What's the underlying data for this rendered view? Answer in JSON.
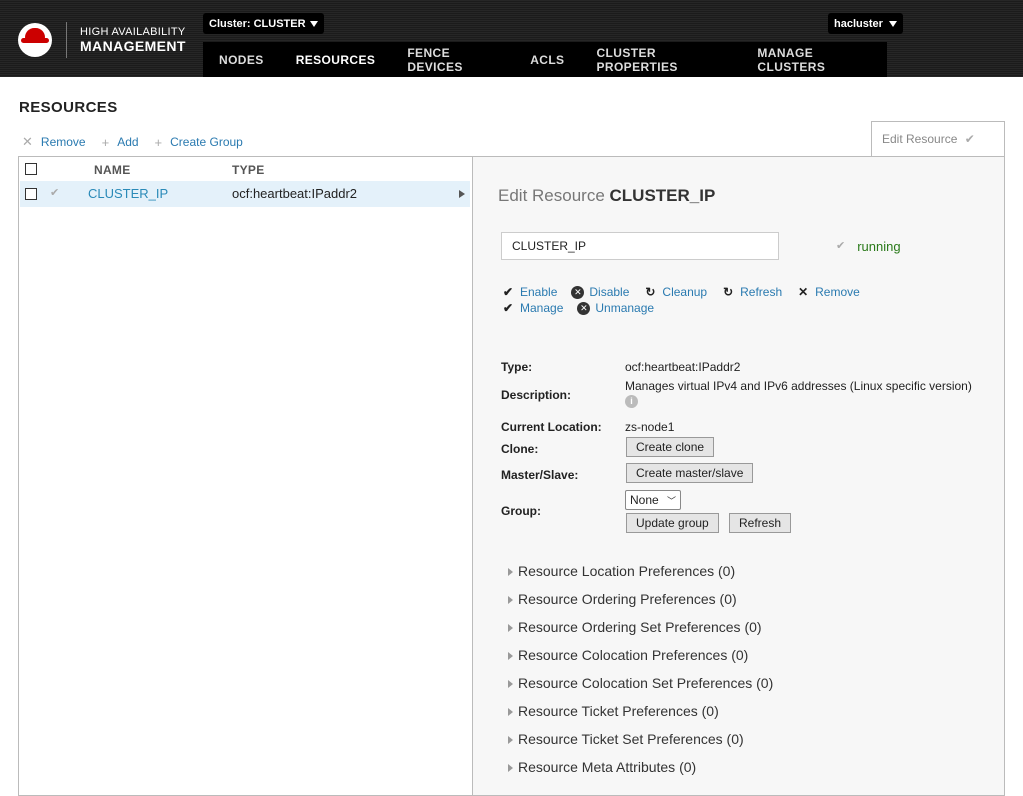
{
  "brand": {
    "line1": "HIGH AVAILABILITY",
    "line2": "MANAGEMENT"
  },
  "cluster_selector": {
    "label": "Cluster: CLUSTER"
  },
  "user_menu": {
    "label": "hacluster"
  },
  "nav": {
    "tabs": [
      {
        "label": "NODES"
      },
      {
        "label": "RESOURCES",
        "active": true
      },
      {
        "label": "FENCE DEVICES"
      },
      {
        "label": "ACLS"
      },
      {
        "label": "CLUSTER PROPERTIES"
      },
      {
        "label": "MANAGE CLUSTERS"
      }
    ]
  },
  "page": {
    "title": "RESOURCES"
  },
  "toolbar": {
    "remove": "Remove",
    "add": "Add",
    "create_group": "Create Group"
  },
  "edit_tab": {
    "label": "Edit Resource"
  },
  "list": {
    "headers": {
      "name": "NAME",
      "type": "TYPE"
    },
    "rows": [
      {
        "name": "CLUSTER_IP",
        "type": "ocf:heartbeat:IPaddr2"
      }
    ]
  },
  "detail": {
    "title_prefix": "Edit Resource",
    "title_name": "CLUSTER_IP",
    "name_value": "CLUSTER_IP",
    "status": "running",
    "actions": {
      "enable": "Enable",
      "disable": "Disable",
      "cleanup": "Cleanup",
      "refresh": "Refresh",
      "remove": "Remove",
      "manage": "Manage",
      "unmanage": "Unmanage"
    },
    "props": {
      "type_label": "Type:",
      "type_value": "ocf:heartbeat:IPaddr2",
      "desc_label": "Description:",
      "desc_value": "Manages virtual IPv4 and IPv6 addresses (Linux specific version)",
      "location_label": "Current Location:",
      "location_value": "zs-node1",
      "clone_label": "Clone:",
      "clone_button": "Create clone",
      "master_label": "Master/Slave:",
      "master_button": "Create master/slave",
      "group_label": "Group:",
      "group_selected": "None",
      "update_group_button": "Update group",
      "refresh_button": "Refresh"
    },
    "sections": [
      "Resource Location Preferences (0)",
      "Resource Ordering Preferences (0)",
      "Resource Ordering Set Preferences (0)",
      "Resource Colocation Preferences (0)",
      "Resource Colocation Set Preferences (0)",
      "Resource Ticket Preferences (0)",
      "Resource Ticket Set Preferences (0)",
      "Resource Meta Attributes (0)"
    ]
  },
  "colors": {
    "link": "#2a7ab0",
    "running": "#2a7a1a",
    "header_bg": "#1d1d1d",
    "selected_row": "#e4f1fa"
  }
}
